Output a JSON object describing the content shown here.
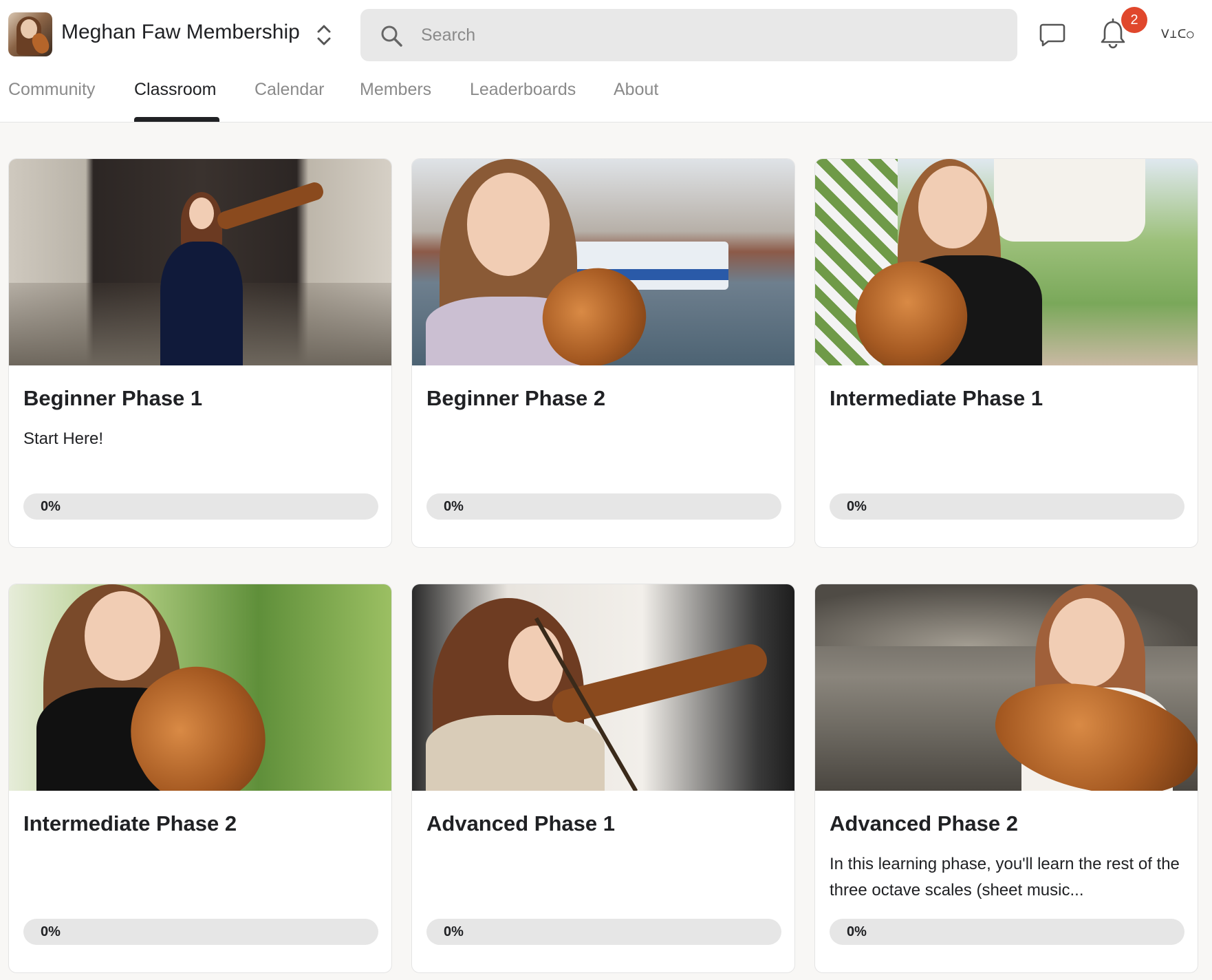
{
  "header": {
    "group_name": "Meghan Faw Membership",
    "search_placeholder": "Search",
    "notification_count": "2",
    "avatar_text": "ᐯ⊥ᑕ○",
    "icons": {
      "logo": "group-logo",
      "switcher": "chevron-up-down-icon",
      "search": "search-icon",
      "chat": "chat-icon",
      "notifications": "bell-icon"
    }
  },
  "tabs": [
    {
      "label": "Community",
      "active": false
    },
    {
      "label": "Classroom",
      "active": true
    },
    {
      "label": "Calendar",
      "active": false
    },
    {
      "label": "Members",
      "active": false
    },
    {
      "label": "Leaderboards",
      "active": false
    },
    {
      "label": "About",
      "active": false
    }
  ],
  "courses": [
    {
      "title": "Beginner Phase 1",
      "description": "Start Here!",
      "progress_label": "0%",
      "progress": 0
    },
    {
      "title": "Beginner Phase 2",
      "description": "",
      "progress_label": "0%",
      "progress": 0
    },
    {
      "title": "Intermediate Phase 1",
      "description": "",
      "progress_label": "0%",
      "progress": 0
    },
    {
      "title": "Intermediate Phase 2",
      "description": "",
      "progress_label": "0%",
      "progress": 0
    },
    {
      "title": "Advanced Phase 1",
      "description": "",
      "progress_label": "0%",
      "progress": 0
    },
    {
      "title": "Advanced Phase 2",
      "description": "In this learning phase, you'll learn the rest of the three octave scales (sheet music...",
      "progress_label": "0%",
      "progress": 0
    }
  ],
  "colors": {
    "accent": "#202124",
    "badge": "#e0472c",
    "muted_tab": "#8a8a8a",
    "progress_track": "#e6e6e6",
    "page_bg": "#f8f7f5"
  }
}
